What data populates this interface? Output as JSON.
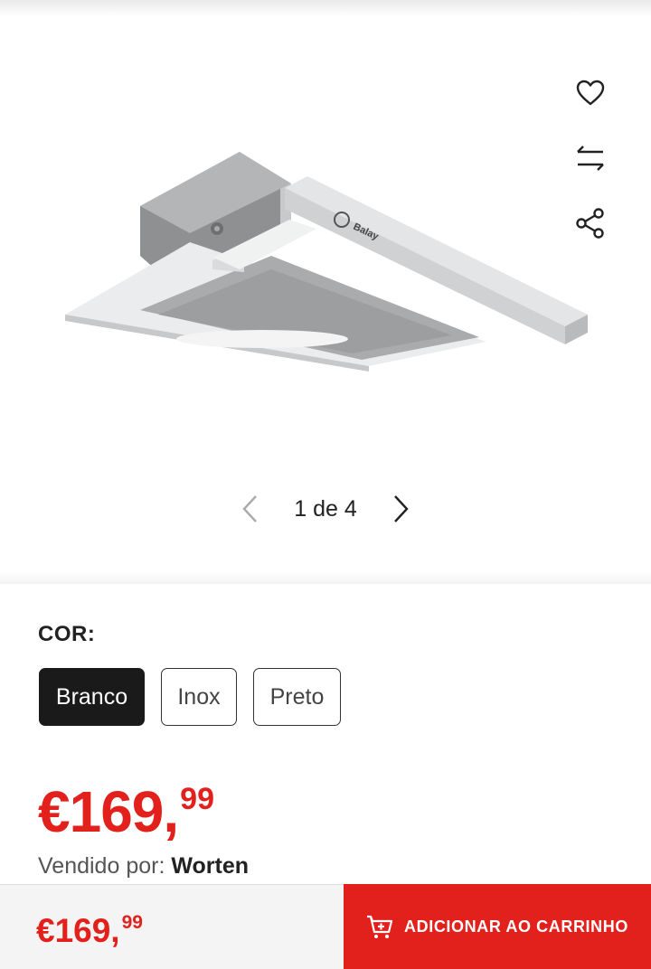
{
  "gallery": {
    "image_alt": "",
    "brand_text": "Balay",
    "pager_text": "1 de 4"
  },
  "actions": {
    "favorite_icon": "heart-icon",
    "compare_icon": "compare-arrows-icon",
    "share_icon": "share-icon"
  },
  "color": {
    "label": "COR:",
    "options": [
      "Branco",
      "Inox",
      "Preto"
    ],
    "selected": "Branco"
  },
  "price": {
    "integer": "€169,",
    "decimals": "99"
  },
  "seller": {
    "prefix": "Vendido por:",
    "name": "Worten"
  },
  "bottom_bar": {
    "price_integer": "€169,",
    "price_decimals": "99",
    "cart_label": "ADICIONAR AO CARRINHO",
    "cart_icon": "cart-add-icon"
  },
  "colors": {
    "accent": "#e2211c",
    "selected_swatch": "#1a1a1a"
  }
}
